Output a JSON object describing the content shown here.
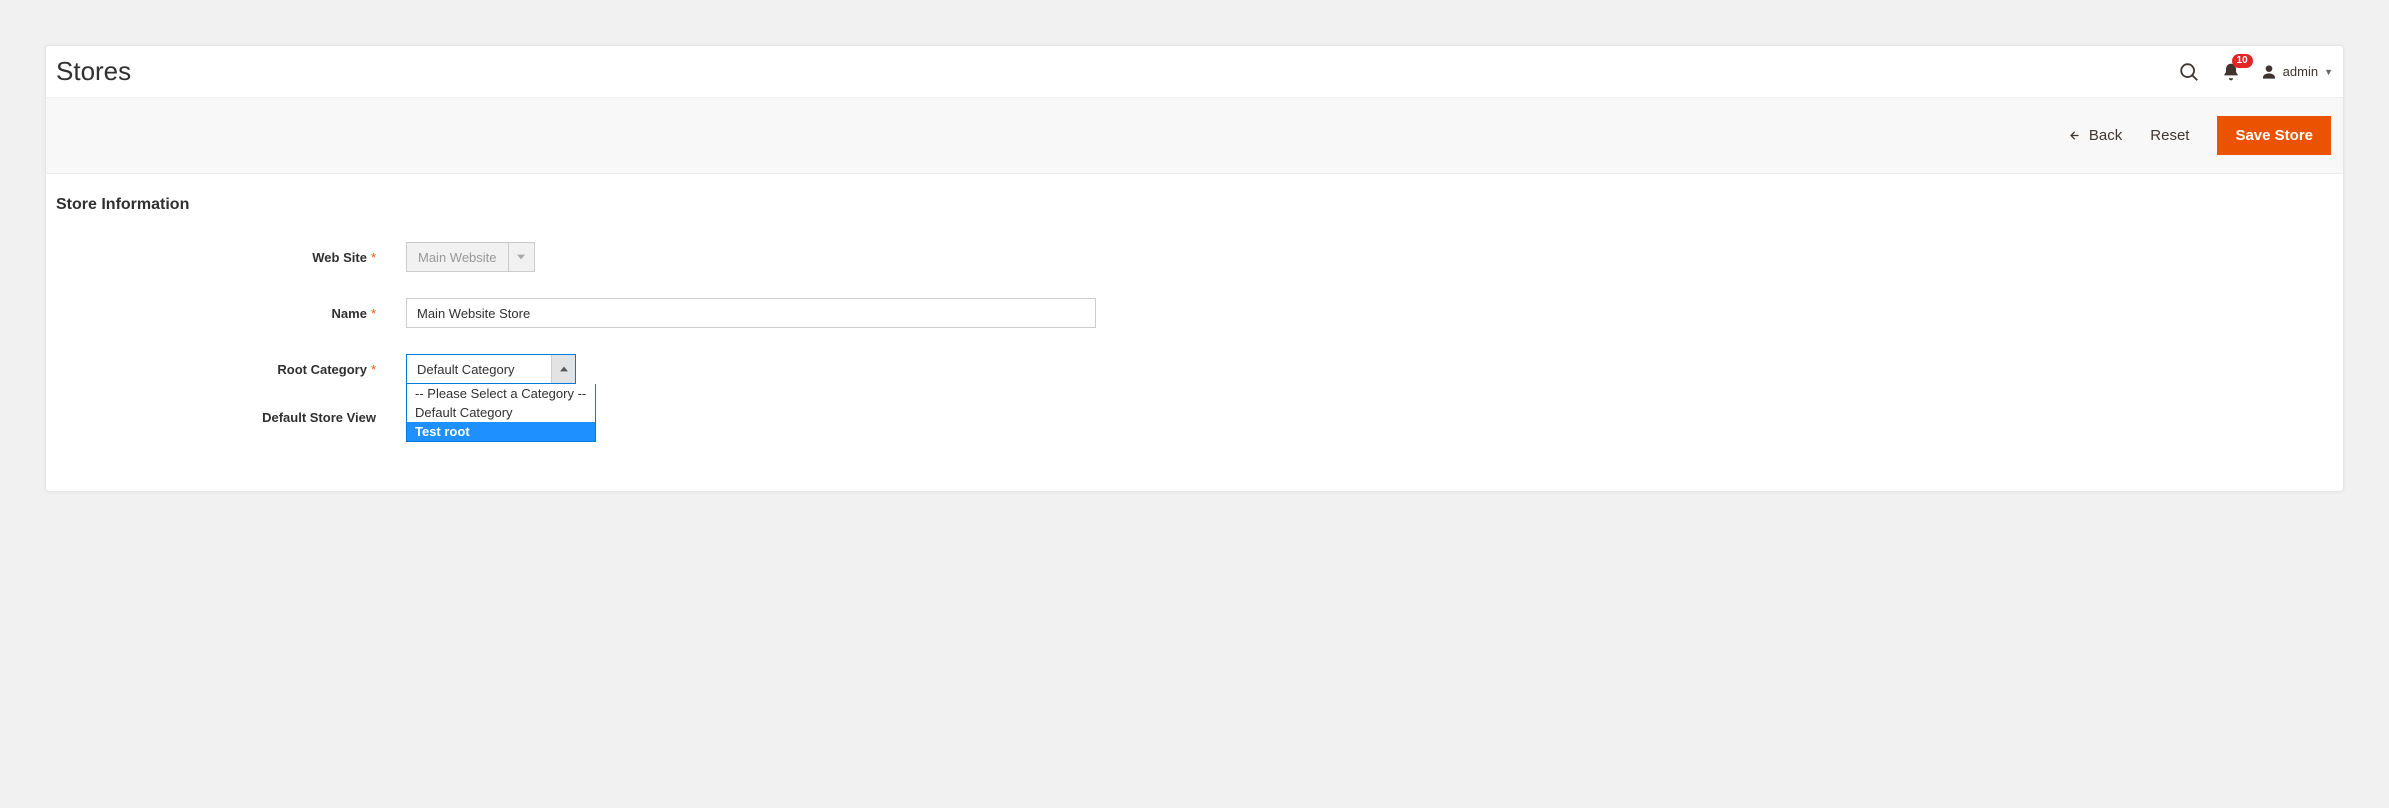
{
  "header": {
    "title": "Stores",
    "notification_count": "10",
    "username": "admin"
  },
  "toolbar": {
    "back_label": "Back",
    "reset_label": "Reset",
    "save_label": "Save Store"
  },
  "section": {
    "title": "Store Information",
    "labels": {
      "website": "Web Site",
      "name": "Name",
      "root_category": "Root Category",
      "default_store_view": "Default Store View"
    },
    "fields": {
      "website_value": "Main Website",
      "name_value": "Main Website Store",
      "root_category_value": "Default Category"
    },
    "root_category_options": [
      {
        "label": "-- Please Select a Category --",
        "highlight": false
      },
      {
        "label": "Default Category",
        "highlight": false
      },
      {
        "label": "Test root",
        "highlight": true
      }
    ]
  }
}
